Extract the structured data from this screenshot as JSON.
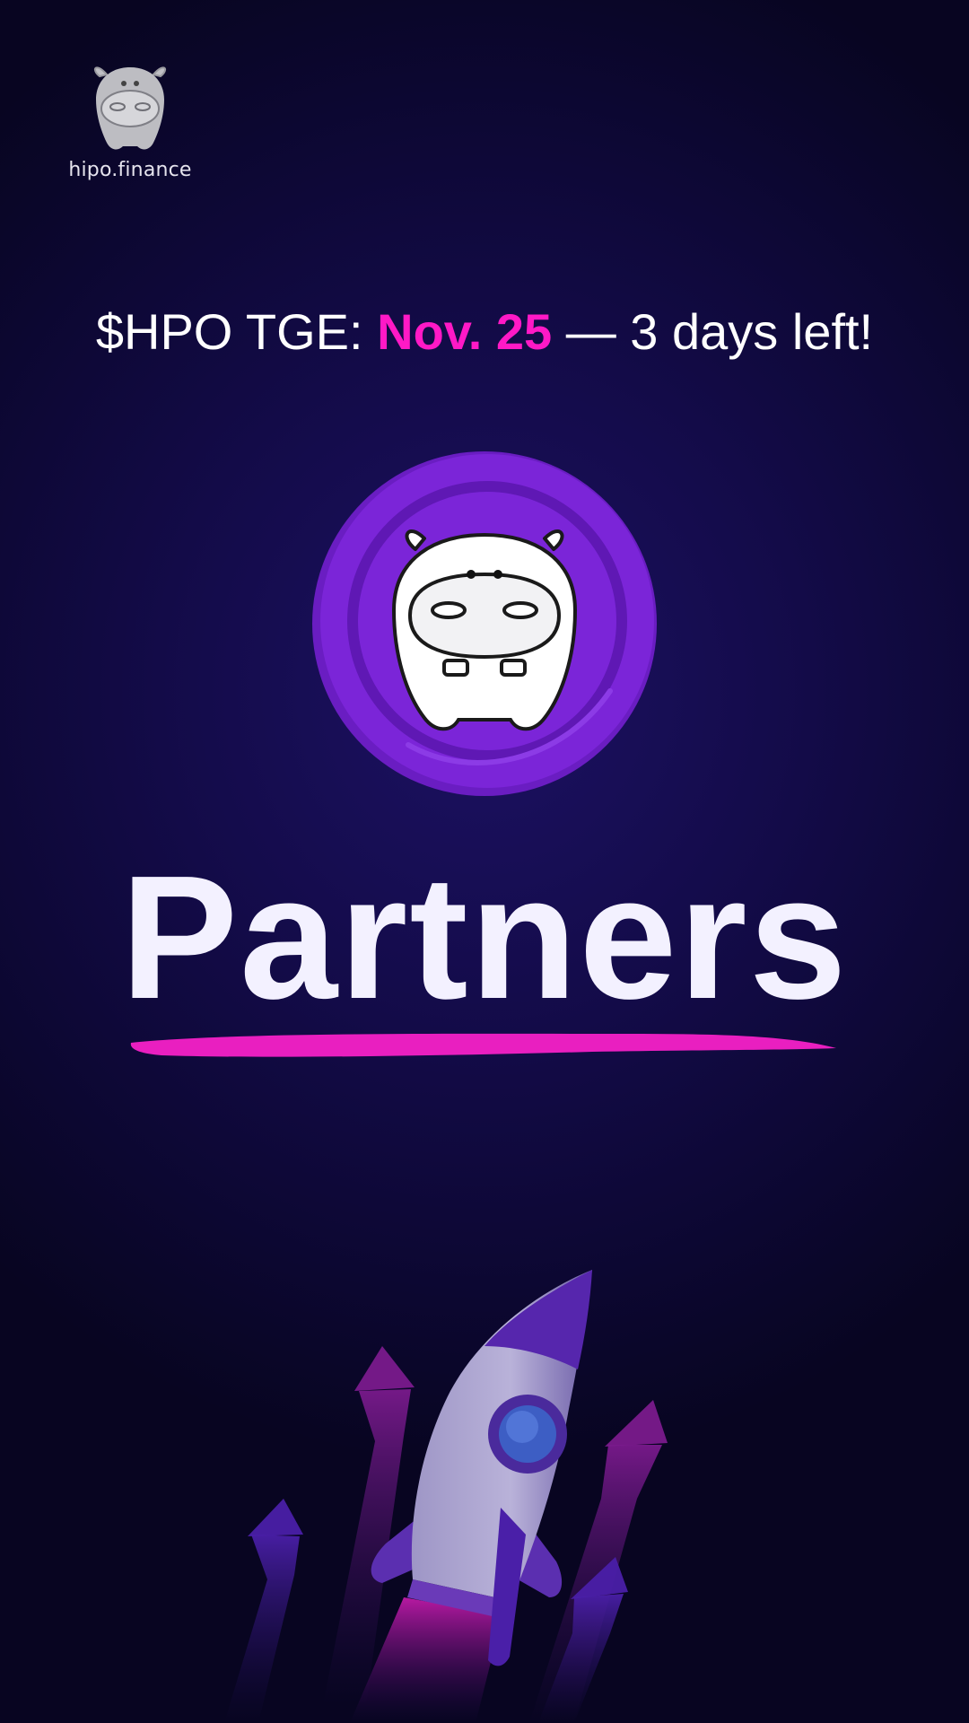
{
  "brand": {
    "name": "hipo.finance",
    "logo_icon": "hippo-head-logo-icon"
  },
  "headline": {
    "prefix": "$HPO TGE: ",
    "date": "Nov. 25",
    "suffix": " — 3 days left!"
  },
  "token": {
    "icon": "hippo-coin-icon"
  },
  "title": "Partners",
  "decor": {
    "underline": "brush-underline",
    "rocket": "rocket-illustration"
  },
  "colors": {
    "background": "#130b48",
    "accent": "#ff19c6",
    "coin": "#7b25d8",
    "text": "#f3f1ff"
  }
}
